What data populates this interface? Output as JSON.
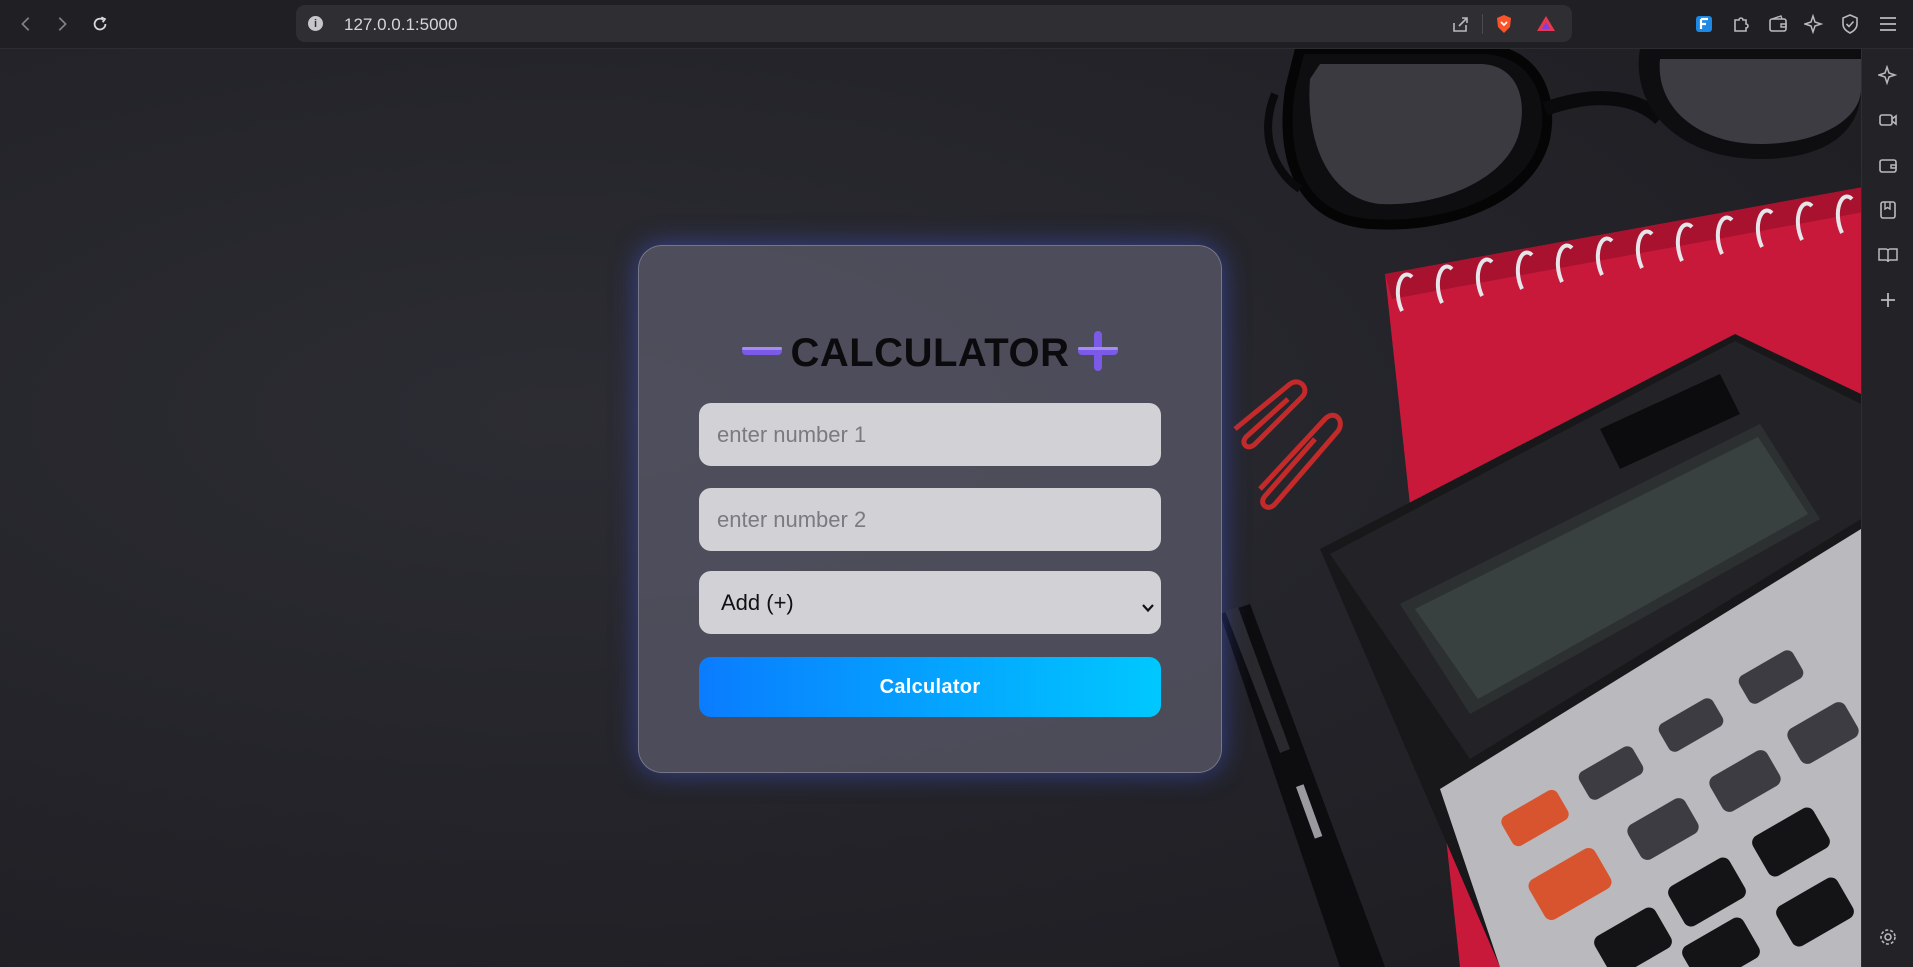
{
  "browser": {
    "url": "127.0.0.1:5000"
  },
  "calculator": {
    "title": "CALCULATOR",
    "number1_placeholder": "enter number 1",
    "number2_placeholder": "enter number 2",
    "operation_selected": "Add (+)",
    "submit_label": "Calculator"
  },
  "colors": {
    "title_icon": "#7a5ae6",
    "button_start": "#0a7cff",
    "button_end": "#00c8ff",
    "card_glow": "#4a5ad8"
  },
  "icons": {
    "title_left": "minus-icon",
    "title_right": "plus-icon"
  }
}
